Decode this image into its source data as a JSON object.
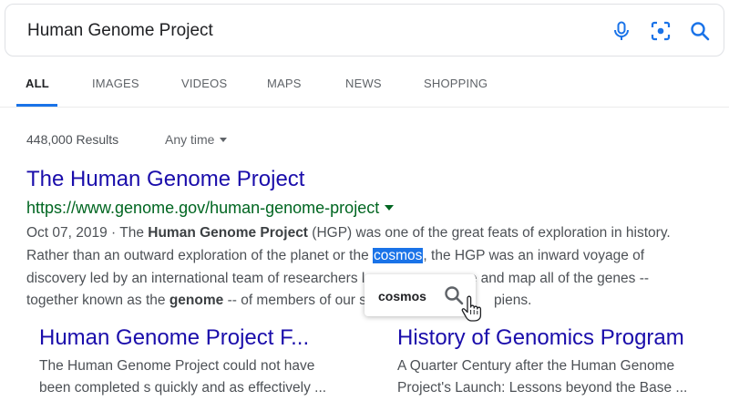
{
  "search": {
    "query": "Human Genome Project",
    "icons": [
      "microphone-icon",
      "lens-icon",
      "search-icon"
    ]
  },
  "tabs": [
    {
      "label": "ALL",
      "active": true
    },
    {
      "label": "IMAGES",
      "active": false
    },
    {
      "label": "VIDEOS",
      "active": false
    },
    {
      "label": "MAPS",
      "active": false
    },
    {
      "label": "NEWS",
      "active": false
    },
    {
      "label": "SHOPPING",
      "active": false
    }
  ],
  "results_meta": {
    "count": "448,000 Results",
    "time_filter": "Any time"
  },
  "result": {
    "title": "The Human Genome Project",
    "url": "https://www.genome.gov/human-genome-project",
    "snippet": {
      "line1_date": "Oct 07, 2019 · The ",
      "line1_bold": "Human Genome Project",
      "line1_rest": " (HGP) was one of the great feats of exploration in history.",
      "line2_pre": "Rather than an outward exploration of the planet or the ",
      "line2_highlight": "cosmos",
      "line2_post": ", the HGP was an inward voyage of",
      "line3_pre": "discovery led by an international team of researchers l",
      "line3_post": "nce and map all of the genes --",
      "line4_pre": "together known as the ",
      "line4_bold": "genome",
      "line4_mid": " -- of members of our s",
      "line4_post": "piens."
    }
  },
  "popup": {
    "word": "cosmos"
  },
  "cards": [
    {
      "title": "Human Genome Project F...",
      "line1": "The Human Genome Project could not have",
      "line2": "been completed s quickly and as effectively ..."
    },
    {
      "title": "History of Genomics Program",
      "line1": "A Quarter Century after the Human Genome",
      "line2": "Project's Launch: Lessons beyond the Base ..."
    }
  ],
  "colors": {
    "link": "#1a0dab",
    "url": "#006621",
    "accent": "#1a73e8",
    "icon": "#1a73e8"
  }
}
